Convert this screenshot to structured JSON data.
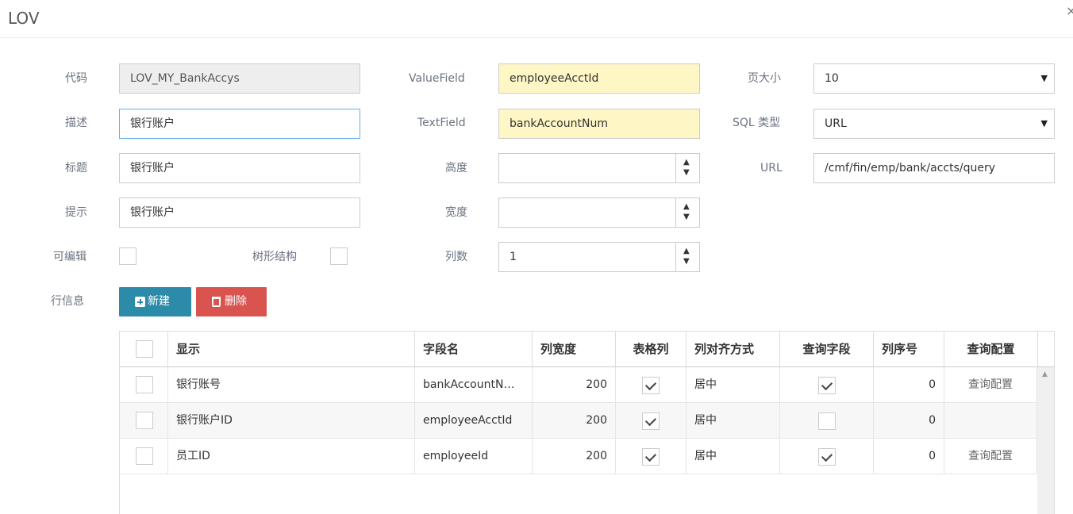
{
  "modal": {
    "title": "LOV",
    "close": "×"
  },
  "form": {
    "code_label": "代码",
    "code_value": "LOV_MY_BankAccys",
    "desc_label": "描述",
    "desc_value": "银行账户",
    "title_label": "标题",
    "title_value": "银行账户",
    "hint_label": "提示",
    "hint_value": "银行账户",
    "editable_label": "可编辑",
    "editable_checked": false,
    "tree_label": "树形结构",
    "tree_checked": false,
    "value_field_label": "ValueField",
    "value_field_value": "employeeAcctId",
    "text_field_label": "TextField",
    "text_field_value": "bankAccountNum",
    "height_label": "高度",
    "height_value": "",
    "width_label": "宽度",
    "width_value": "",
    "columns_label": "列数",
    "columns_value": "1",
    "page_size_label": "页大小",
    "page_size_value": "10",
    "sql_type_label": "SQL 类型",
    "sql_type_value": "URL",
    "url_label": "URL",
    "url_value": "/cmf/fin/emp/bank/accts/query",
    "spin_up": "▲",
    "spin_down": "▼",
    "select_arrow": "▼"
  },
  "rows_section": {
    "label": "行信息",
    "new_button": "新建",
    "delete_button": "删除"
  },
  "grid": {
    "headers": [
      "显示",
      "字段名",
      "列宽度",
      "表格列",
      "列对齐方式",
      "查询字段",
      "列序号",
      "查询配置"
    ],
    "rows": [
      {
        "display": "银行账号",
        "field": "bankAccountN…",
        "width": "200",
        "is_column": true,
        "align": "居中",
        "is_query": true,
        "order": "0",
        "query_config": "查询配置"
      },
      {
        "display": "银行账户ID",
        "field": "employeeAcctId",
        "width": "200",
        "is_column": true,
        "align": "居中",
        "is_query": false,
        "order": "0",
        "query_config": ""
      },
      {
        "display": "员工ID",
        "field": "employeeId",
        "width": "200",
        "is_column": true,
        "align": "居中",
        "is_query": true,
        "order": "0",
        "query_config": "查询配置"
      }
    ],
    "scroll_up": "▲"
  },
  "colors": {
    "primary": "#2c8ba8",
    "danger": "#d9534f",
    "highlight": "#fff6c6"
  }
}
